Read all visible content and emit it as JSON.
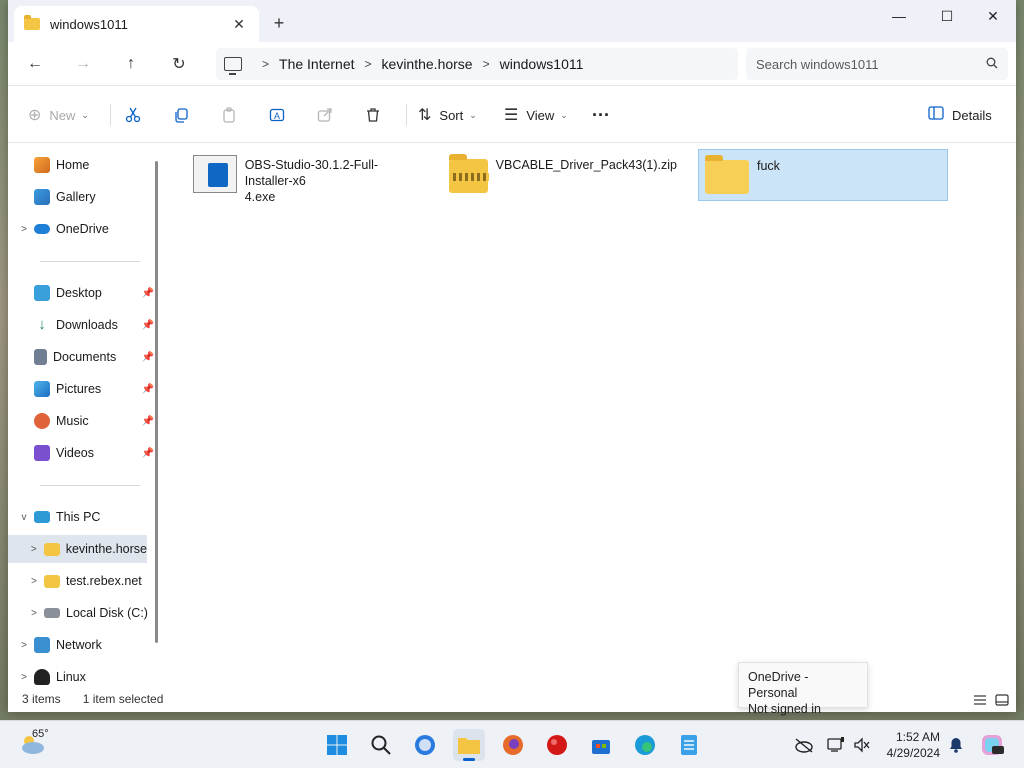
{
  "window": {
    "tab_title": "windows1011",
    "new_tab": "+",
    "close_tab": "✕",
    "minimize": "—",
    "maximize": "☐",
    "close": "✕"
  },
  "nav": {
    "back": "←",
    "forward": "→",
    "up": "↑",
    "refresh": "↻"
  },
  "breadcrumb": [
    "The Internet",
    "kevinthe.horse",
    "windows1011"
  ],
  "search": {
    "placeholder": "Search windows1011"
  },
  "toolbar": {
    "new_label": "New",
    "sort_label": "Sort",
    "view_label": "View",
    "more_label": "···",
    "details_label": "Details"
  },
  "sidebar": {
    "quick": [
      {
        "label": "Home"
      },
      {
        "label": "Gallery"
      },
      {
        "label": "OneDrive"
      }
    ],
    "pinned": [
      {
        "label": "Desktop"
      },
      {
        "label": "Downloads"
      },
      {
        "label": "Documents"
      },
      {
        "label": "Pictures"
      },
      {
        "label": "Music"
      },
      {
        "label": "Videos"
      }
    ],
    "tree": [
      {
        "label": "This PC"
      },
      {
        "label": "kevinthe.horse"
      },
      {
        "label": "test.rebex.net"
      },
      {
        "label": "Local Disk (C:)"
      },
      {
        "label": "Network"
      },
      {
        "label": "Linux"
      }
    ]
  },
  "files": [
    {
      "name": "OBS-Studio-30.1.2-Full-Installer-x64.exe",
      "line1": "OBS-Studio-30.1.2-Full-Installer-x6",
      "line2": "4.exe",
      "type": "exe"
    },
    {
      "name": "VBCABLE_Driver_Pack43(1).zip",
      "type": "zip"
    },
    {
      "name": "fuck",
      "type": "folder",
      "selected": true
    }
  ],
  "status": {
    "items": "3 items",
    "selected": "1 item selected"
  },
  "tooltip": {
    "line1": "OneDrive - Personal",
    "line2": "Not signed in"
  },
  "taskbar": {
    "temperature": "65°",
    "time": "1:52 AM",
    "date": "4/29/2024"
  },
  "colors": {
    "accent": "#0a61c9",
    "selection": "#cce4f7",
    "folder": "#f4c542"
  }
}
